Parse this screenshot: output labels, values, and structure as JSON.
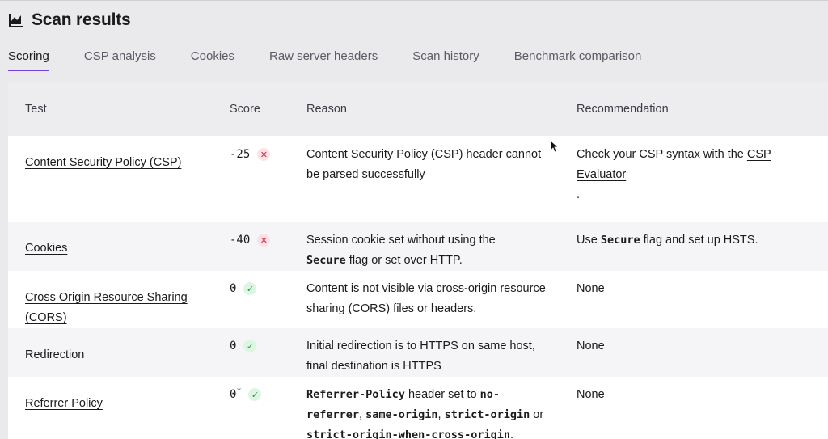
{
  "header": {
    "title": "Scan results",
    "icon": "chart-area-icon"
  },
  "tabs": [
    {
      "label": "Scoring",
      "active": true
    },
    {
      "label": "CSP analysis",
      "active": false
    },
    {
      "label": "Cookies",
      "active": false
    },
    {
      "label": "Raw server headers",
      "active": false
    },
    {
      "label": "Scan history",
      "active": false
    },
    {
      "label": "Benchmark comparison",
      "active": false
    }
  ],
  "table": {
    "columns": {
      "test": "Test",
      "score": "Score",
      "reason": "Reason",
      "recommendation": "Recommendation"
    },
    "rows": [
      {
        "test": "Content Security Policy (CSP)",
        "score": "-25",
        "status": "fail",
        "reason": "Content Security Policy (CSP) header cannot be parsed successfully",
        "rec_prefix": "Check your CSP syntax with the ",
        "rec_link": "CSP Evaluator",
        "rec_suffix": "."
      },
      {
        "test": "Cookies",
        "score": "-40",
        "status": "fail",
        "reason_prefix": "Session cookie set without using the ",
        "reason_code": "Secure",
        "reason_suffix": " flag or set over HTTP.",
        "rec_prefix": "Use ",
        "rec_code": "Secure",
        "rec_suffix": " flag and set up HSTS."
      },
      {
        "test": "Cross Origin Resource Sharing (CORS)",
        "score": "0",
        "status": "pass",
        "reason": "Content is not visible via cross-origin resource sharing (CORS) files or headers.",
        "rec": "None"
      },
      {
        "test": "Redirection",
        "score": "0",
        "status": "pass",
        "reason": "Initial redirection is to HTTPS on same host, final destination is HTTPS",
        "rec": "None"
      },
      {
        "test": "Referrer Policy",
        "score": "0",
        "score_sup": "*",
        "status": "pass",
        "reason_code1": "Referrer-Policy",
        "reason_text1": " header set to ",
        "reason_code2": "no-referrer",
        "reason_text2": ", ",
        "reason_code3": "same-origin",
        "reason_text3": ", ",
        "reason_code4": "strict-origin",
        "reason_text4": " or ",
        "reason_code5": "strict-origin-when-cross-origin",
        "reason_text5": ".",
        "rec": "None"
      }
    ]
  },
  "colors": {
    "accent": "#7542e5",
    "fail": "#d7264c",
    "pass": "#1f9b45"
  }
}
